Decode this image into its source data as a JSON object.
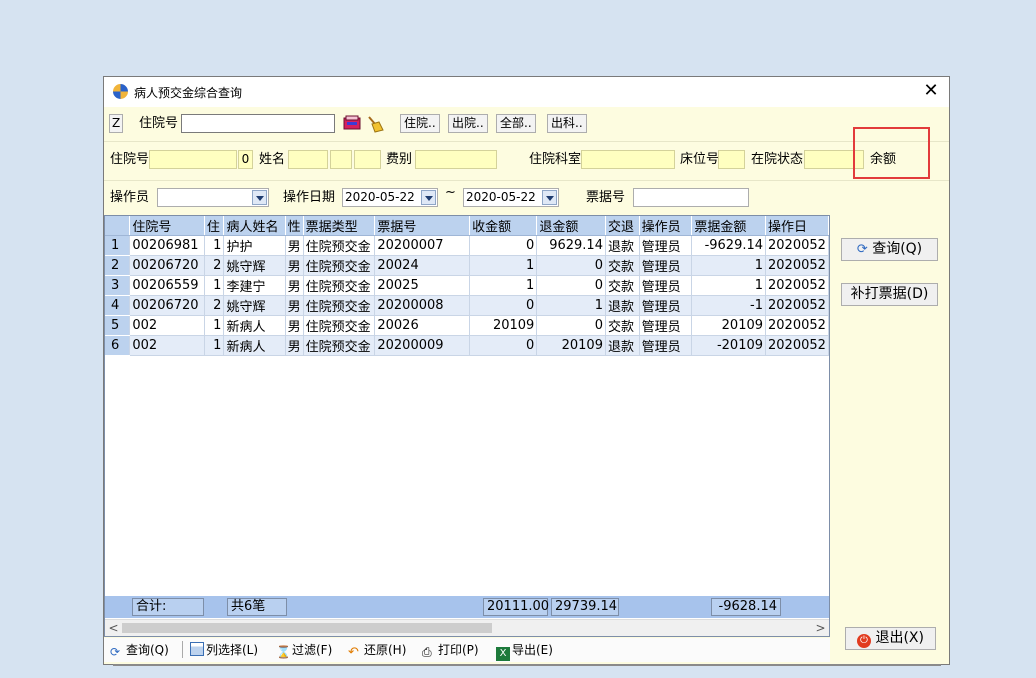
{
  "window": {
    "title": "病人预交金综合查询",
    "close": "✕"
  },
  "toolbar": {
    "z_label": "Z",
    "inpatient_label": "住院号",
    "inpatient_value": "",
    "btn_in": "住院..",
    "btn_out": "出院..",
    "btn_all": "全部..",
    "btn_dept": "出科.."
  },
  "info": {
    "inpatient_label": "住院号",
    "zero": "0",
    "name_label": "姓名",
    "fee_label": "费别",
    "dept_label": "住院科室",
    "bed_label": "床位号",
    "status_label": "在院状态",
    "balance_label": "余额"
  },
  "filter": {
    "operator_label": "操作员",
    "operator_value": "",
    "date_label": "操作日期",
    "date_from": "2020-05-22",
    "tilde": "~",
    "date_to": "2020-05-22",
    "receipt_label": "票据号",
    "receipt_value": ""
  },
  "table": {
    "columns": [
      "住院号",
      "住",
      "病人姓名",
      "性",
      "票据类型",
      "票据号",
      "收金额",
      "退金额",
      "交退",
      "操作员",
      "票据金额",
      "操作日"
    ],
    "rows": [
      {
        "n": "1",
        "c": [
          "00206981",
          "1",
          "护护",
          "男",
          "住院预交金",
          "20200007",
          "0",
          "9629.14",
          "退款",
          "管理员",
          "-9629.14",
          "2020052"
        ]
      },
      {
        "n": "2",
        "c": [
          "00206720",
          "2",
          "姚守辉",
          "男",
          "住院预交金",
          "20024",
          "1",
          "0",
          "交款",
          "管理员",
          "1",
          "2020052"
        ]
      },
      {
        "n": "3",
        "c": [
          "00206559",
          "1",
          "李建宁",
          "男",
          "住院预交金",
          "20025",
          "1",
          "0",
          "交款",
          "管理员",
          "1",
          "2020052"
        ]
      },
      {
        "n": "4",
        "c": [
          "00206720",
          "2",
          "姚守辉",
          "男",
          "住院预交金",
          "20200008",
          "0",
          "1",
          "退款",
          "管理员",
          "-1",
          "2020052"
        ]
      },
      {
        "n": "5",
        "c": [
          "002",
          "1",
          "新病人",
          "男",
          "住院预交金",
          "20026",
          "20109",
          "0",
          "交款",
          "管理员",
          "20109",
          "2020052"
        ]
      },
      {
        "n": "6",
        "c": [
          "002",
          "1",
          "新病人",
          "男",
          "住院预交金",
          "20200009",
          "0",
          "20109",
          "退款",
          "管理员",
          "-20109",
          "2020052"
        ]
      }
    ],
    "summary": {
      "total_label": "合计:",
      "count": "共6笔",
      "received": "20111.00",
      "refunded": "29739.14",
      "amount": "-9628.14"
    }
  },
  "side": {
    "query": "查询(Q)",
    "reprint": "补打票据(D)",
    "exit": "退出(X)"
  },
  "bottom": {
    "query": "查询(Q)",
    "columns": "列选择(L)",
    "filter": "过滤(F)",
    "restore": "还原(H)",
    "print": "打印(P)",
    "export": "导出(E)"
  },
  "colors": {
    "accent": "#bcd2ee",
    "field": "#ffffc0",
    "highlight": "#e23b3b"
  }
}
